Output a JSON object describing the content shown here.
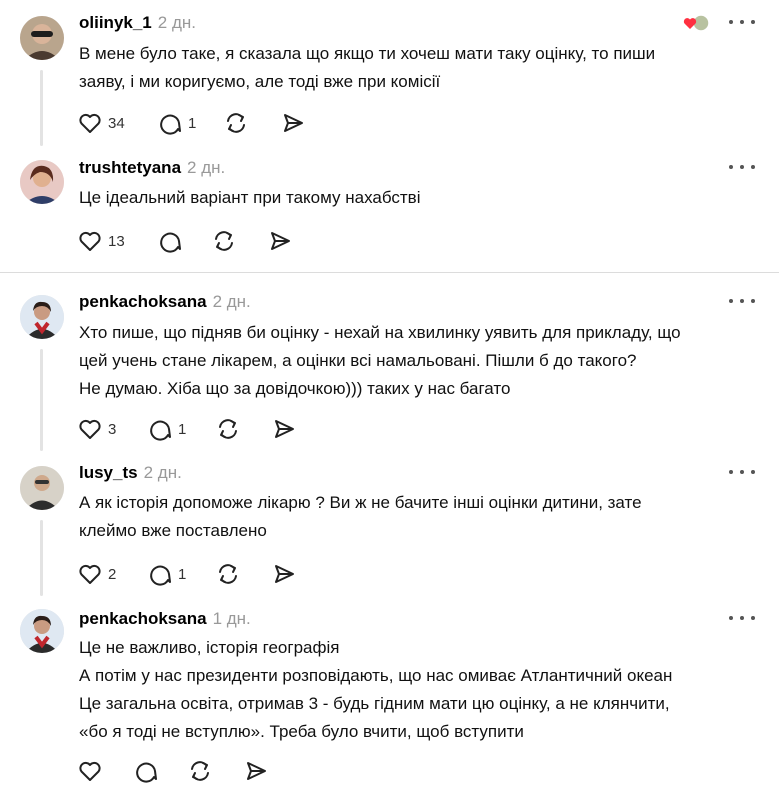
{
  "posts": [
    {
      "username": "oliinyk_1",
      "time": "2 дн.",
      "lines": [
        "В мене було таке, я сказала що якщо ти хочеш мати таку оцінку, то пиши",
        "заяву, і ми коригуємо, але тоді вже при комісії"
      ],
      "likes": "34",
      "replies": "1",
      "avatar_icon": "avatar-dark-glasses"
    },
    {
      "username": "trushtetyana",
      "time": "2 дн.",
      "lines": [
        "Це ідеальний варіант при такому нахабстві"
      ],
      "likes": "13",
      "replies": "",
      "avatar_icon": "avatar-woman-brown-hair"
    },
    {
      "username": "penkachoksana",
      "time": "2 дн.",
      "lines": [
        "Хто пише, що підняв би оцінку - нехай на хвилинку уявить для прикладу, що",
        "цей учень стане лікарем, а оцінки всі намальовані. Пішли б до такого?",
        "Не думаю. Хіба що за довідочкою))) таких у нас багато"
      ],
      "likes": "3",
      "replies": "1",
      "avatar_icon": "avatar-woman-red-scarf"
    },
    {
      "username": "lusy_ts",
      "time": "2 дн.",
      "lines": [
        "А як історія допоможе лікарю ? Ви ж не бачите інші оцінки дитини, зате",
        "клеймо вже поставлено"
      ],
      "likes": "2",
      "replies": "1",
      "avatar_icon": "avatar-person-glasses"
    },
    {
      "username": "penkachoksana",
      "time": "1 дн.",
      "lines": [
        "Це не важливо, історія географія",
        "А потім у нас президенти розповідають, що нас омиває Атлантичний океан",
        "Це загальна освіта, отримав 3 - будь гідним мати цю оцінку, а не клянчити,",
        "«бо я тоді не вступлю». Треба було вчити, щоб вступити"
      ],
      "likes": "",
      "replies": "",
      "avatar_icon": "avatar-woman-red-scarf"
    }
  ],
  "colors": {
    "timestamp": "#999999",
    "divider": "#dcdcdc",
    "thread_line": "#e3e3e3",
    "reaction_heart": "#ff3040"
  },
  "icons": [
    "heart-icon",
    "comment-icon",
    "repost-icon",
    "share-icon",
    "more-icon"
  ]
}
